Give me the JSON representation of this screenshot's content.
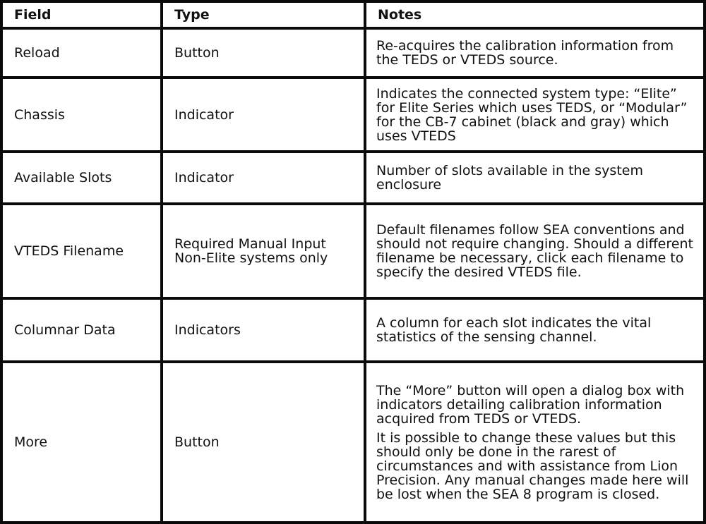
{
  "table": {
    "headers": [
      "Field",
      "Type",
      "Notes"
    ],
    "rows": [
      {
        "field": "Reload",
        "type": [
          "Button"
        ],
        "notes": [
          "Re-acquires the calibration information from the TEDS or VTEDS source."
        ]
      },
      {
        "field": "Chassis",
        "type": [
          "Indicator"
        ],
        "notes": [
          "Indicates the connected system type: “Elite” for Elite Series which uses TEDS, or “Modular” for the CB-7 cabinet (black and gray) which uses VTEDS"
        ]
      },
      {
        "field": "Available Slots",
        "type": [
          "Indicator"
        ],
        "notes": [
          "Number of slots available in the system enclosure"
        ]
      },
      {
        "field": "VTEDS Filename",
        "type": [
          "Required Manual Input",
          "Non-Elite systems only"
        ],
        "notes": [
          "Default filenames follow SEA conventions and should not require changing. Should a different filename be necessary, click each filename to specify the desired VTEDS file."
        ]
      },
      {
        "field": "Columnar Data",
        "type": [
          "Indicators"
        ],
        "notes": [
          "A column for each slot indicates the vital statistics of the sensing channel."
        ]
      },
      {
        "field": "More",
        "type": [
          "Button"
        ],
        "notes": [
          "The “More” button will open a dialog box with indicators detailing calibration information acquired from TEDS or VTEDS.",
          "It is possible to change these values but this should only be done in the rarest of circumstances and with assistance from Lion Precision. Any manual changes made here will be lost when the SEA 8 program is closed."
        ]
      }
    ]
  }
}
